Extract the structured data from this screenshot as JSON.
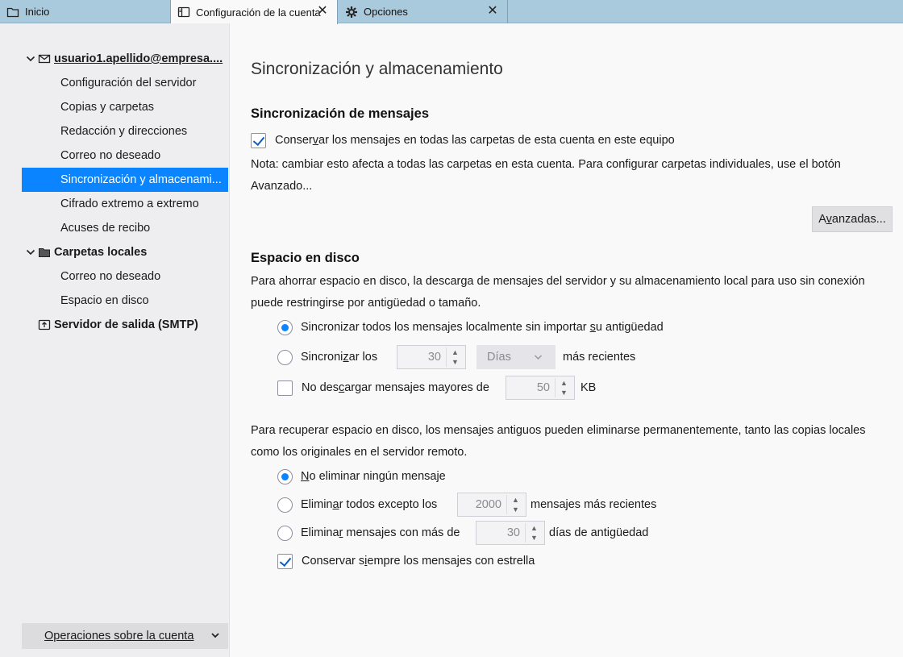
{
  "tabs": [
    {
      "label": "Inicio",
      "icon": "folder-icon"
    },
    {
      "label": "Configuración de la cuenta",
      "icon": "account-settings-icon",
      "close": "✕"
    },
    {
      "label": "Opciones",
      "icon": "gear-icon",
      "close": "✕"
    }
  ],
  "sidebar": {
    "account": "usuario1.apellido@empresa....",
    "account_items": [
      "Configuración del servidor",
      "Copias y carpetas",
      "Redacción y direcciones",
      "Correo no deseado",
      "Sincronización y almacenami...",
      "Cifrado extremo a extremo",
      "Acuses de recibo"
    ],
    "selected_index": 4,
    "local_folders": "Carpetas locales",
    "local_items": [
      "Correo no deseado",
      "Espacio en disco"
    ],
    "smtp": "Servidor de salida (SMTP)",
    "ops_button": "Operaciones sobre la cuenta"
  },
  "main": {
    "title": "Sincronización y almacenamiento",
    "sync_section": {
      "title": "Sincronización de mensajes",
      "keep_messages_pre": "Conser",
      "keep_messages_u": "v",
      "keep_messages_post": "ar los mensajes en todas las carpetas de esta cuenta en este equipo",
      "keep_messages_checked": true,
      "note": "Nota: cambiar esto afecta a todas las carpetas en esta cuenta. Para configurar carpetas individuales, use el botón Avanzado...",
      "advanced_pre": "A",
      "advanced_u": "v",
      "advanced_post": "anzadas..."
    },
    "disk_section": {
      "title": "Espacio en disco",
      "intro": "Para ahorrar espacio en disco, la descarga de mensajes del servidor y su almacenamiento local para uso sin conexión puede restringirse por antigüedad o tamaño.",
      "opt_all_pre": "Sincronizar todos los mensajes localmente sin importar ",
      "opt_all_u": "s",
      "opt_all_post": "u antigüedad",
      "opt_recent_pre": "Sincroni",
      "opt_recent_u": "z",
      "opt_recent_post": "ar los",
      "recent_value": "30",
      "recent_unit": "Días",
      "recent_suffix": "más recientes",
      "no_download_pre": "No des",
      "no_download_u": "c",
      "no_download_post": "argar mensajes mayores de",
      "size_value": "50",
      "size_unit": "KB",
      "cleanup_intro": "Para recuperar espacio en disco, los mensajes antiguos pueden eliminarse permanentemente, tanto las copias locales como los originales en el servidor remoto.",
      "del_none_u": "N",
      "del_none_post": "o eliminar ningún mensaje",
      "del_except_pre": "Elimin",
      "del_except_u": "a",
      "del_except_post": "r todos excepto los",
      "except_value": "2000",
      "except_suffix": "mensajes más recientes",
      "del_older_pre": "Elimina",
      "del_older_u": "r",
      "del_older_post": " mensajes con más de",
      "older_value": "30",
      "older_suffix": "días de antigüedad",
      "keep_star_pre": "Conservar s",
      "keep_star_u": "i",
      "keep_star_post": "empre los mensajes con estrella",
      "keep_star_checked": true
    }
  },
  "colors": {
    "selected": "#0a84ff",
    "tabbar": "#a9c9dc"
  }
}
